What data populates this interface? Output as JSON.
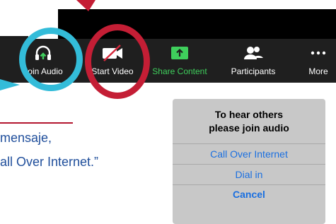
{
  "toolbar": {
    "items": [
      {
        "label": "Join Audio",
        "icon": "headphones-icon"
      },
      {
        "label": "Start Video",
        "icon": "video-off-icon"
      },
      {
        "label": "Share Content",
        "icon": "share-screen-icon"
      },
      {
        "label": "Participants",
        "icon": "participants-icon"
      },
      {
        "label": "More",
        "icon": "more-icon"
      }
    ]
  },
  "annotation": {
    "line1": "mensaje,",
    "line2": "all Over Internet.”"
  },
  "dialog": {
    "title": "To hear others\nplease join audio",
    "options": [
      "Call Over Internet",
      "Dial in"
    ],
    "cancel": "Cancel"
  },
  "colors": {
    "highlight_blue": "#33bcd9",
    "highlight_red": "#c41e35",
    "link_blue": "#1a6fe0",
    "share_green": "#3fcf5c"
  }
}
